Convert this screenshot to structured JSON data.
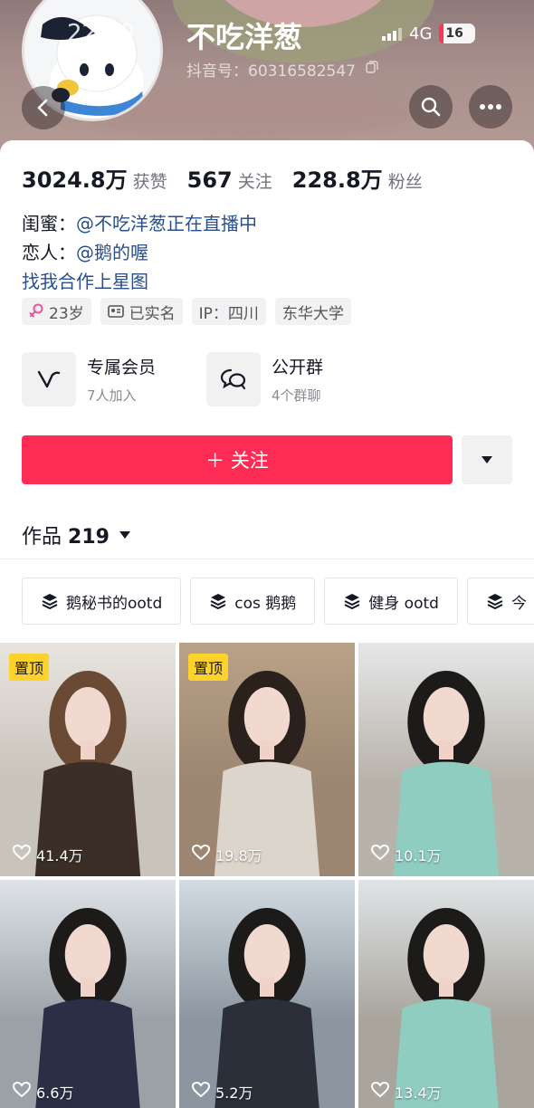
{
  "status_bar": {
    "time": "22:59",
    "network": "4G",
    "battery": "16"
  },
  "profile": {
    "name": "不吃洋葱",
    "douyin_id": "抖音号：60316582547"
  },
  "stats": [
    {
      "value": "3024.8万",
      "label": "获赞"
    },
    {
      "value": "567",
      "label": "关注"
    },
    {
      "value": "228.8万",
      "label": "粉丝"
    }
  ],
  "bio": {
    "line1_key": "闺蜜：",
    "line1_val": "@不吃洋葱正在直播中",
    "line2_key": "恋人：",
    "line2_val": "@鹅的喔",
    "line3": "找我合作上星图"
  },
  "tags": [
    "23岁",
    "已实名",
    "IP：四川",
    "东华大学"
  ],
  "features": [
    {
      "title": "专属会员",
      "sub": "7人加入"
    },
    {
      "title": "公开群",
      "sub": "4个群聊"
    }
  ],
  "follow_button": "＋ 关注",
  "works": {
    "label": "作品",
    "count": "219"
  },
  "collections": [
    "鹅秘书的ootd",
    "cos 鹅鹅",
    "健身 ootd",
    "今"
  ],
  "grid": [
    {
      "pinned": "置顶",
      "likes": "41.4万",
      "bg": "#c8c3bb",
      "top": "#e8e4de",
      "cloth": "#3a2e27",
      "hair": "#6b4a35"
    },
    {
      "pinned": "置顶",
      "likes": "19.8万",
      "bg": "#9c8672",
      "top": "#b9a287",
      "cloth": "#dcd5cb",
      "hair": "#2a201c"
    },
    {
      "pinned": "",
      "likes": "10.1万",
      "bg": "#b7b2aa",
      "top": "#e5e7e8",
      "cloth": "#8fcdc0",
      "hair": "#1d1a1a"
    },
    {
      "pinned": "",
      "likes": "6.6万",
      "bg": "#9aa2a8",
      "top": "#dfe3e7",
      "cloth": "#2a2f45",
      "hair": "#1d1a1a"
    },
    {
      "pinned": "",
      "likes": "5.2万",
      "bg": "#8b96a0",
      "top": "#d3dbe2",
      "cloth": "#2a2f3a",
      "hair": "#1d1a1a"
    },
    {
      "pinned": "",
      "likes": "13.4万",
      "bg": "#a9a59d",
      "top": "#dfe4e7",
      "cloth": "#8fcdc0",
      "hair": "#1d1a1a"
    }
  ],
  "colors": {
    "accent": "#fe2c55",
    "link": "#2a4f8a",
    "pin": "#fcd22b"
  }
}
